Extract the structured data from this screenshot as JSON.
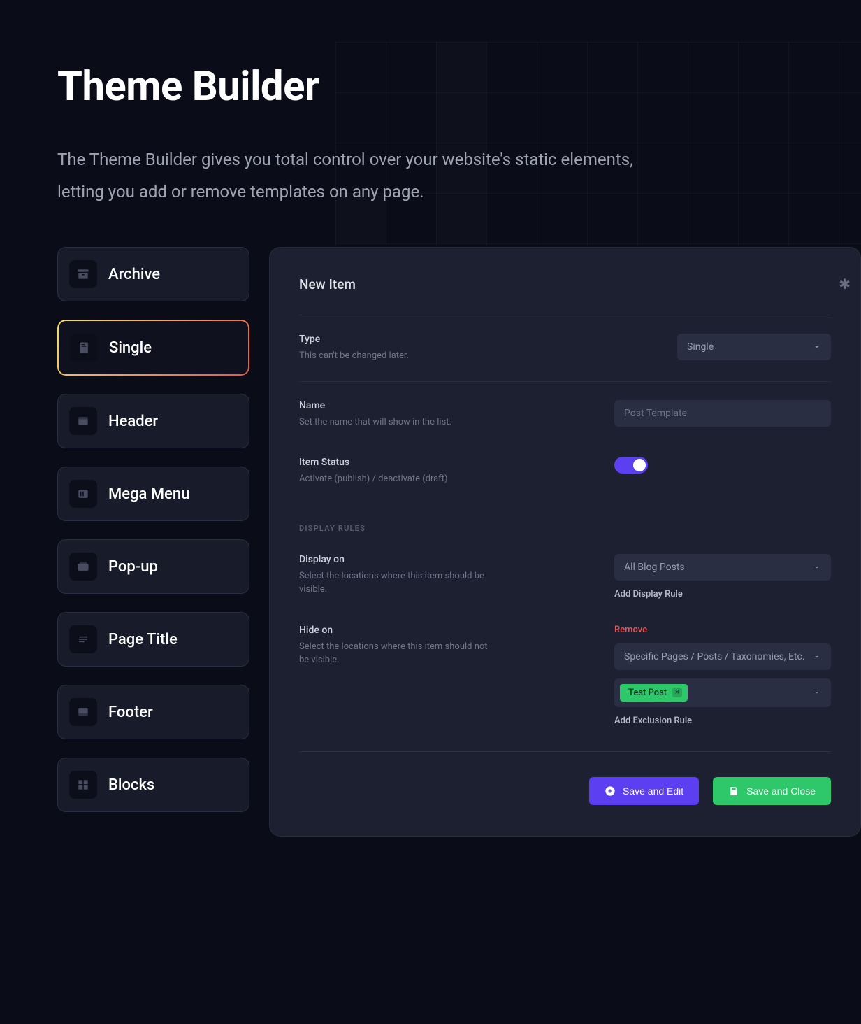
{
  "header": {
    "title": "Theme Builder",
    "description": "The Theme Builder gives you total control over your website's static elements, letting you add or remove templates on any page."
  },
  "sidebar": {
    "items": [
      {
        "label": "Archive",
        "icon": "archive",
        "active": false
      },
      {
        "label": "Single",
        "icon": "document",
        "active": true
      },
      {
        "label": "Header",
        "icon": "header",
        "active": false
      },
      {
        "label": "Mega Menu",
        "icon": "megamenu",
        "active": false
      },
      {
        "label": "Pop-up",
        "icon": "popup",
        "active": false
      },
      {
        "label": "Page Title",
        "icon": "pagetitle",
        "active": false
      },
      {
        "label": "Footer",
        "icon": "footer",
        "active": false
      },
      {
        "label": "Blocks",
        "icon": "blocks",
        "active": false
      }
    ]
  },
  "panel": {
    "title": "New Item",
    "type": {
      "label": "Type",
      "hint": "This can't be changed later.",
      "value": "Single"
    },
    "name": {
      "label": "Name",
      "hint": "Set the name that will show in the list.",
      "placeholder": "Post Template"
    },
    "status": {
      "label": "Item Status",
      "hint": "Activate (publish) / deactivate (draft)",
      "value": true
    },
    "display_rules_label": "DISPLAY RULES",
    "display_on": {
      "label": "Display on",
      "hint": "Select the locations where this item should be visible.",
      "value": "All Blog Posts",
      "add_link": "Add Display Rule"
    },
    "hide_on": {
      "label": "Hide on",
      "hint": "Select the locations where this item should not be visible.",
      "remove_link": "Remove",
      "value": "Specific Pages / Posts / Taxonomies, Etc.",
      "tag": "Test Post",
      "add_link": "Add Exclusion Rule"
    },
    "footer": {
      "save_edit": "Save and Edit",
      "save_close": "Save and Close"
    }
  }
}
